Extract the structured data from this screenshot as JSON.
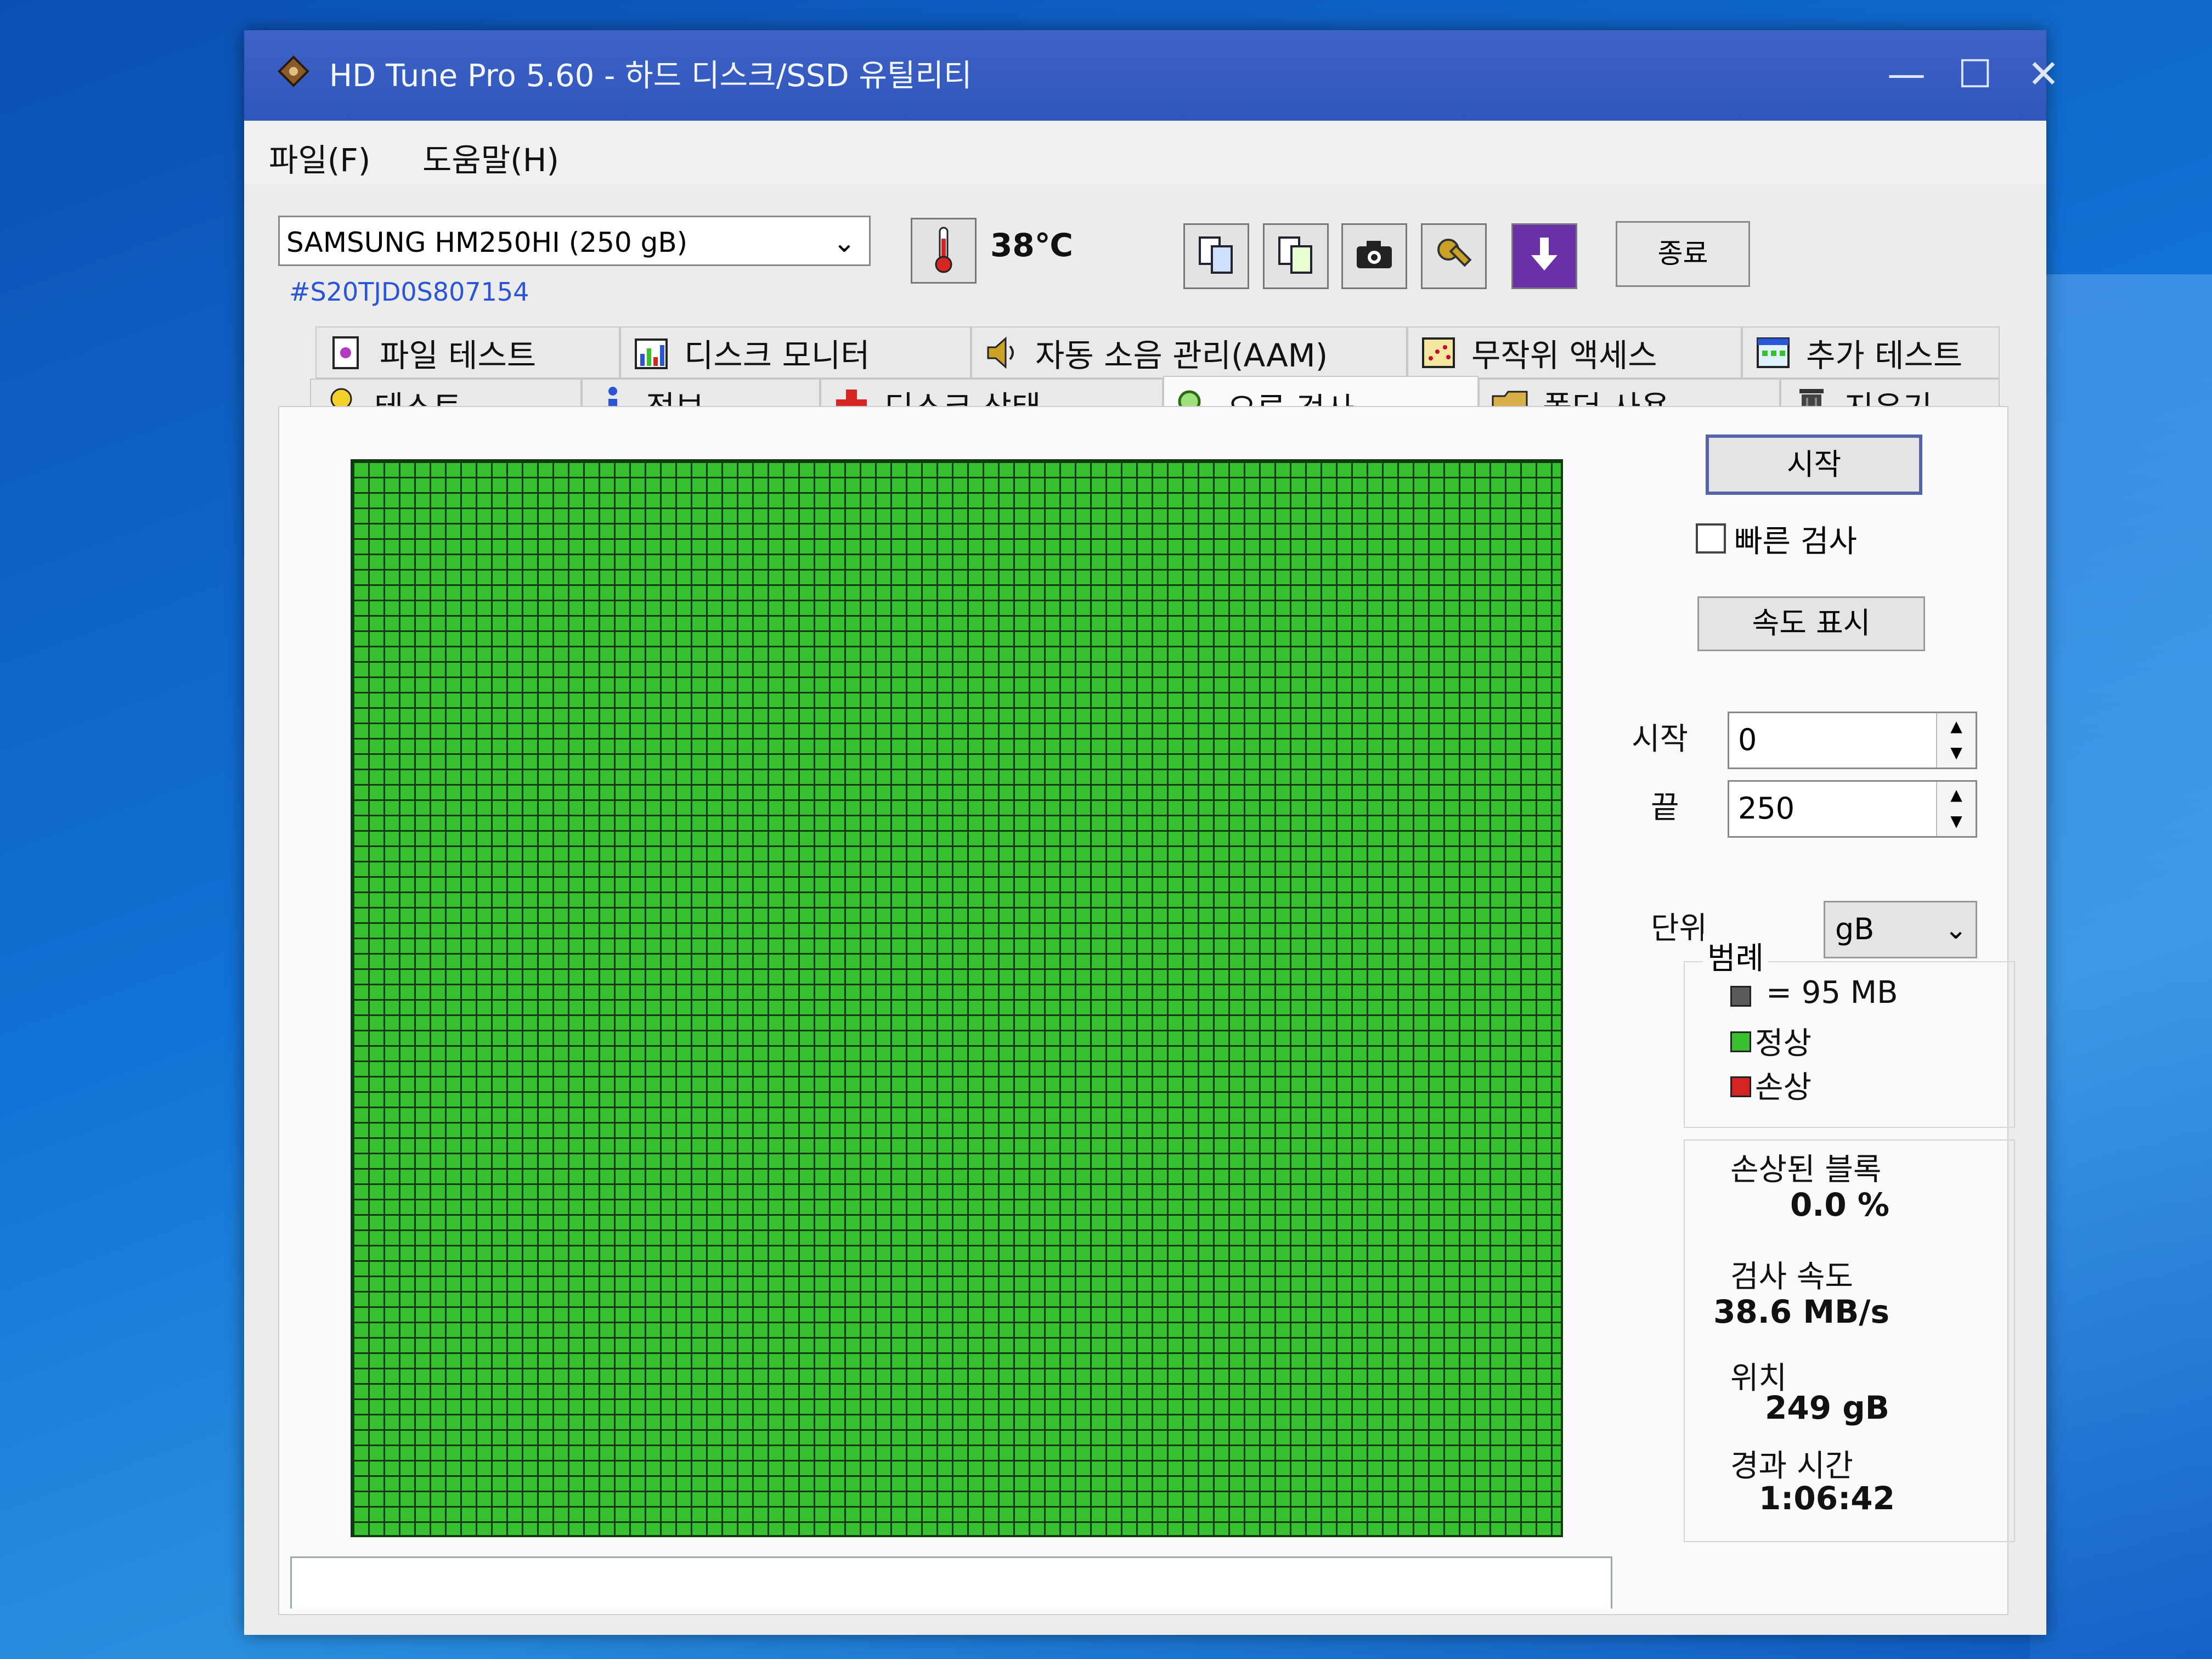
{
  "window": {
    "title": "HD Tune Pro 5.60 - 하드 디스크/SSD 유틸리티",
    "minimize": "—",
    "maximize": "☐",
    "close": "✕"
  },
  "menu": [
    "파일(F)",
    "도움말(H)"
  ],
  "toolbar": {
    "drive": "SAMSUNG HM250HI (250 gB)",
    "serial": "#S20TJD0S807154",
    "temperature": "38℃",
    "exit": "종료"
  },
  "tabs_row1": [
    {
      "label": "파일 테스트",
      "icon": "file-test-icon"
    },
    {
      "label": "디스크 모니터",
      "icon": "disk-monitor-icon"
    },
    {
      "label": "자동 소음 관리(AAM)",
      "icon": "speaker-icon"
    },
    {
      "label": "무작위 액세스",
      "icon": "random-access-icon"
    },
    {
      "label": "추가 테스트",
      "icon": "extra-test-icon"
    }
  ],
  "tabs_row2": [
    {
      "label": "테스트",
      "icon": "bulb-icon"
    },
    {
      "label": "정보",
      "icon": "info-icon"
    },
    {
      "label": "디스크 상태",
      "icon": "health-cross-icon"
    },
    {
      "label": "오류 검사",
      "icon": "magnifier-icon",
      "active": true
    },
    {
      "label": "폴더 사용",
      "icon": "folder-icon"
    },
    {
      "label": "지우기",
      "icon": "trash-icon"
    }
  ],
  "error_scan": {
    "start_button": "시작",
    "quick_scan": "빠른 검사",
    "quick_scan_checked": false,
    "speed_button": "속도 표시",
    "start_label": "시작",
    "start_value": "0",
    "end_label": "끝",
    "end_value": "250",
    "unit_label": "단위",
    "unit_value": "gB",
    "legend_title": "범례",
    "legend": [
      {
        "label": "= 95 MB",
        "color": "#5a5a5a"
      },
      {
        "label": "정상",
        "color": "#39c031"
      },
      {
        "label": "손상",
        "color": "#d42424"
      }
    ],
    "damaged_blocks_label": "손상된 블록",
    "damaged_blocks_value": "0.0 %",
    "scan_speed_label": "검사 속도",
    "scan_speed_value": "38.6 MB/s",
    "position_label": "위치",
    "position_value": "249 gB",
    "elapsed_label": "경과 시간",
    "elapsed_value": "1:06:42"
  },
  "colors": {
    "titlebar": "#2f56bd",
    "block_ok": "#39c031",
    "block_damaged": "#d42424",
    "grid_line": "#0f3b0f"
  }
}
